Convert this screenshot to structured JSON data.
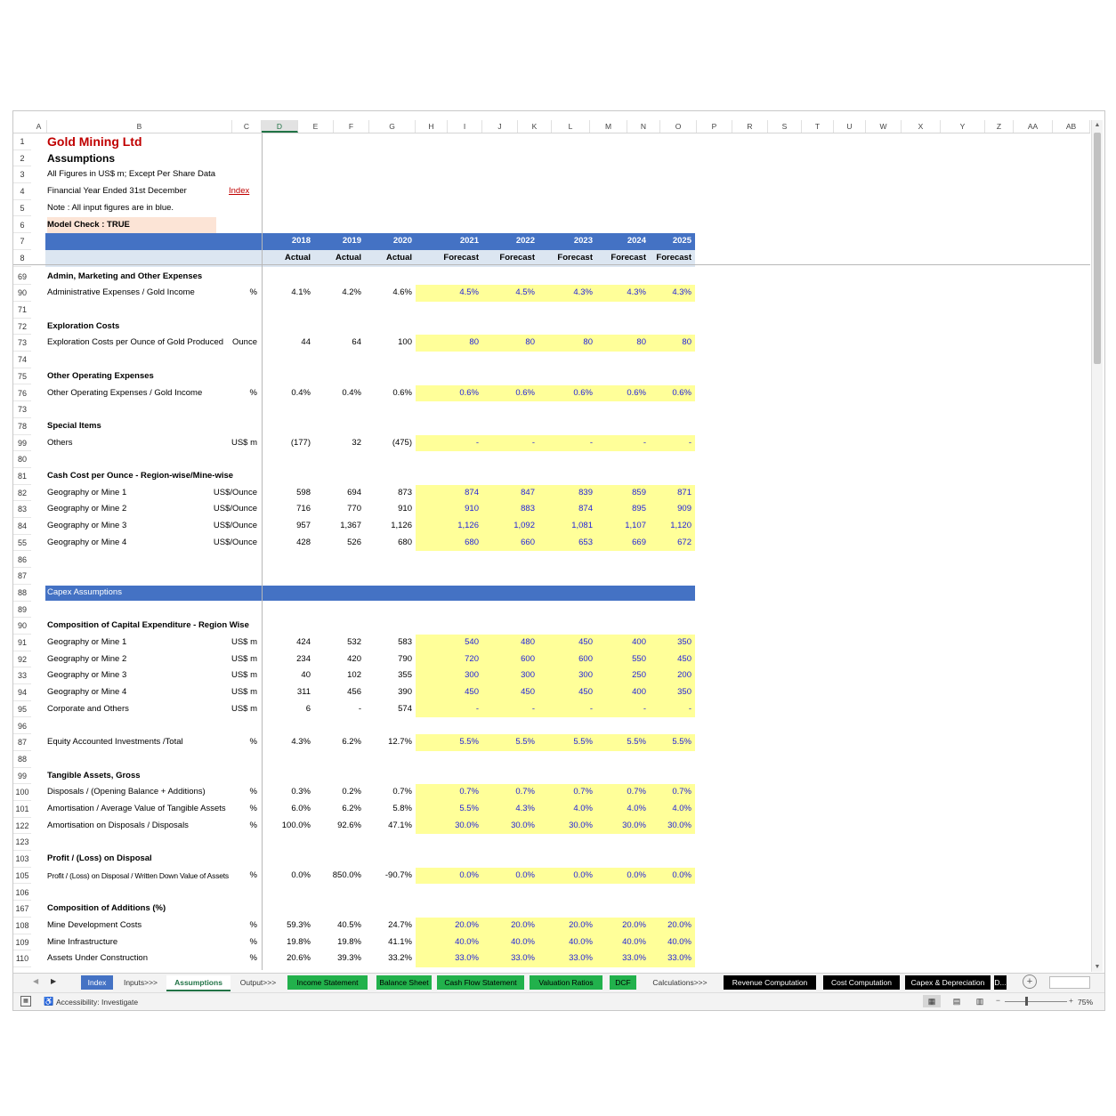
{
  "columns": [
    "A",
    "B",
    "C",
    "D",
    "E",
    "F",
    "G",
    "H",
    "I",
    "J",
    "K",
    "L",
    "M",
    "N",
    "O",
    "P",
    "R",
    "S",
    "T",
    "U",
    "W",
    "X",
    "Y",
    "Z",
    "AA",
    "AB"
  ],
  "header_rows": [
    {
      "rn": "1",
      "label": "Gold Mining Ltd"
    },
    {
      "rn": "2",
      "label": "Assumptions"
    },
    {
      "rn": "3",
      "label": "All Figures in US$ m; Except Per Share Data"
    },
    {
      "rn": "4",
      "label": "Financial Year Ended 31st December",
      "link": "Index"
    },
    {
      "rn": "5",
      "label": "Note : All input figures are in blue."
    },
    {
      "rn": "6",
      "label": "Model Check : TRUE"
    }
  ],
  "years": [
    "2018",
    "2019",
    "2020",
    "2021",
    "2022",
    "2023",
    "2024",
    "2025"
  ],
  "year_row_num": "7",
  "type_row_num": "8",
  "year_types": [
    "Actual",
    "Actual",
    "Actual",
    "Forecast",
    "Forecast",
    "Forecast",
    "Forecast",
    "Forecast"
  ],
  "rows": [
    {
      "rn": "69",
      "label": "Admin, Marketing and Other Expenses",
      "bold": true
    },
    {
      "rn": "90",
      "label": "Administrative Expenses / Gold Income",
      "unit": "%",
      "v": [
        "4.1%",
        "4.2%",
        "4.6%",
        "4.5%",
        "4.5%",
        "4.3%",
        "4.3%",
        "4.3%"
      ]
    },
    {
      "rn": "71",
      "label": ""
    },
    {
      "rn": "72",
      "label": "Exploration Costs",
      "bold": true
    },
    {
      "rn": "73",
      "label": "Exploration Costs per Ounce of Gold Produced",
      "unit": "Ounce",
      "v": [
        "44",
        "64",
        "100",
        "80",
        "80",
        "80",
        "80",
        "80"
      ]
    },
    {
      "rn": "74",
      "label": ""
    },
    {
      "rn": "75",
      "label": "Other Operating Expenses",
      "bold": true
    },
    {
      "rn": "76",
      "label": "Other Operating Expenses / Gold Income",
      "unit": "%",
      "v": [
        "0.4%",
        "0.4%",
        "0.6%",
        "0.6%",
        "0.6%",
        "0.6%",
        "0.6%",
        "0.6%"
      ]
    },
    {
      "rn": "73",
      "label": ""
    },
    {
      "rn": "78",
      "label": "Special Items",
      "bold": true
    },
    {
      "rn": "99",
      "label": "Others",
      "unit": "US$ m",
      "v": [
        "(177)",
        "32",
        "(475)",
        "-",
        "-",
        "-",
        "-",
        "-"
      ]
    },
    {
      "rn": "80",
      "label": ""
    },
    {
      "rn": "81",
      "label": "Cash Cost per Ounce - Region-wise/Mine-wise",
      "bold": true
    },
    {
      "rn": "82",
      "label": "Geography or Mine 1",
      "unit": "US$/Ounce",
      "v": [
        "598",
        "694",
        "873",
        "874",
        "847",
        "839",
        "859",
        "871"
      ]
    },
    {
      "rn": "83",
      "label": "Geography or Mine 2",
      "unit": "US$/Ounce",
      "v": [
        "716",
        "770",
        "910",
        "910",
        "883",
        "874",
        "895",
        "909"
      ]
    },
    {
      "rn": "84",
      "label": "Geography or Mine 3",
      "unit": "US$/Ounce",
      "v": [
        "957",
        "1,367",
        "1,126",
        "1,126",
        "1,092",
        "1,081",
        "1,107",
        "1,120"
      ]
    },
    {
      "rn": "55",
      "label": "Geography or Mine 4",
      "unit": "US$/Ounce",
      "v": [
        "428",
        "526",
        "680",
        "680",
        "660",
        "653",
        "669",
        "672"
      ]
    },
    {
      "rn": "86",
      "label": ""
    },
    {
      "rn": "87",
      "label": ""
    },
    {
      "rn": "88",
      "label": "Capex Assumptions",
      "section": true
    },
    {
      "rn": "89",
      "label": ""
    },
    {
      "rn": "90",
      "label": "Composition of Capital Expenditure - Region Wise",
      "bold": true
    },
    {
      "rn": "91",
      "label": "Geography or Mine 1",
      "unit": "US$ m",
      "v": [
        "424",
        "532",
        "583",
        "540",
        "480",
        "450",
        "400",
        "350"
      ]
    },
    {
      "rn": "92",
      "label": "Geography or Mine 2",
      "unit": "US$ m",
      "v": [
        "234",
        "420",
        "790",
        "720",
        "600",
        "600",
        "550",
        "450"
      ]
    },
    {
      "rn": "33",
      "label": "Geography or Mine 3",
      "unit": "US$ m",
      "v": [
        "40",
        "102",
        "355",
        "300",
        "300",
        "300",
        "250",
        "200"
      ]
    },
    {
      "rn": "94",
      "label": "Geography or Mine 4",
      "unit": "US$ m",
      "v": [
        "311",
        "456",
        "390",
        "450",
        "450",
        "450",
        "400",
        "350"
      ]
    },
    {
      "rn": "95",
      "label": "Corporate and Others",
      "unit": "US$ m",
      "v": [
        "6",
        "-",
        "574",
        "-",
        "-",
        "-",
        "-",
        "-"
      ]
    },
    {
      "rn": "96",
      "label": ""
    },
    {
      "rn": "87",
      "label": "Equity Accounted Investments /Total",
      "unit": "%",
      "v": [
        "4.3%",
        "6.2%",
        "12.7%",
        "5.5%",
        "5.5%",
        "5.5%",
        "5.5%",
        "5.5%"
      ]
    },
    {
      "rn": "88",
      "label": ""
    },
    {
      "rn": "99",
      "label": "Tangible Assets, Gross",
      "bold": true
    },
    {
      "rn": "100",
      "label": "Disposals / (Opening Balance + Additions)",
      "unit": "%",
      "v": [
        "0.3%",
        "0.2%",
        "0.7%",
        "0.7%",
        "0.7%",
        "0.7%",
        "0.7%",
        "0.7%"
      ]
    },
    {
      "rn": "101",
      "label": "Amortisation / Average Value of Tangible Assets",
      "unit": "%",
      "v": [
        "6.0%",
        "6.2%",
        "5.8%",
        "5.5%",
        "4.3%",
        "4.0%",
        "4.0%",
        "4.0%"
      ]
    },
    {
      "rn": "122",
      "label": "Amortisation on Disposals / Disposals",
      "unit": "%",
      "v": [
        "100.0%",
        "92.6%",
        "47.1%",
        "30.0%",
        "30.0%",
        "30.0%",
        "30.0%",
        "30.0%"
      ]
    },
    {
      "rn": "123",
      "label": ""
    },
    {
      "rn": "103",
      "label": "Profit / (Loss) on Disposal",
      "bold": true
    },
    {
      "rn": "105",
      "label": "Profit / (Loss) on Disposal / Written Down Value of Assets",
      "unit": "%",
      "small": true,
      "v": [
        "0.0%",
        "850.0%",
        "-90.7%",
        "0.0%",
        "0.0%",
        "0.0%",
        "0.0%",
        "0.0%"
      ]
    },
    {
      "rn": "106",
      "label": ""
    },
    {
      "rn": "167",
      "label": "Composition of Additions (%)",
      "bold": true
    },
    {
      "rn": "108",
      "label": "Mine Development Costs",
      "unit": "%",
      "v": [
        "59.3%",
        "40.5%",
        "24.7%",
        "20.0%",
        "20.0%",
        "20.0%",
        "20.0%",
        "20.0%"
      ]
    },
    {
      "rn": "109",
      "label": "Mine Infrastructure",
      "unit": "%",
      "v": [
        "19.8%",
        "19.8%",
        "41.1%",
        "40.0%",
        "40.0%",
        "40.0%",
        "40.0%",
        "40.0%"
      ]
    },
    {
      "rn": "110",
      "label": "Assets Under Construction",
      "unit": "%",
      "v": [
        "20.6%",
        "39.3%",
        "33.2%",
        "33.0%",
        "33.0%",
        "33.0%",
        "33.0%",
        "33.0%"
      ]
    }
  ],
  "tabs": [
    {
      "label": "Index",
      "bg": "#4472c4",
      "fg": "#ffffff"
    },
    {
      "label": "Inputs>>>",
      "bg": "#f3f3f3",
      "fg": "#333333"
    },
    {
      "label": "Assumptions",
      "bg": "#ffffff",
      "fg": "#217346",
      "active": true
    },
    {
      "label": "Output>>>",
      "bg": "#f3f3f3",
      "fg": "#333333"
    },
    {
      "label": "Income Statement",
      "bg": "#22b14c",
      "fg": "#000000"
    },
    {
      "label": "Balance Sheet",
      "bg": "#22b14c",
      "fg": "#000000"
    },
    {
      "label": "Cash Flow Statement",
      "bg": "#22b14c",
      "fg": "#000000"
    },
    {
      "label": "Valuation Ratios",
      "bg": "#22b14c",
      "fg": "#000000"
    },
    {
      "label": "DCF",
      "bg": "#22b14c",
      "fg": "#000000"
    },
    {
      "label": "Calculations>>>",
      "bg": "#f3f3f3",
      "fg": "#333333"
    },
    {
      "label": "Revenue Computation",
      "bg": "#000000",
      "fg": "#ffffff"
    },
    {
      "label": "Cost Computation",
      "bg": "#000000",
      "fg": "#ffffff"
    },
    {
      "label": "Capex & Depreciation",
      "bg": "#000000",
      "fg": "#ffffff"
    },
    {
      "label": "D...",
      "bg": "#000000",
      "fg": "#ffffff"
    }
  ],
  "status": {
    "accessibility": "Accessibility: Investigate",
    "zoom": "75%"
  },
  "colors": {
    "title": "#c00000",
    "header_bar": "#4472c4",
    "subheader_bar": "#dce6f1",
    "forecast_bg": "#ffff99",
    "input_blue": "#1f1fdb",
    "model_check_bg": "#fce4d6"
  }
}
